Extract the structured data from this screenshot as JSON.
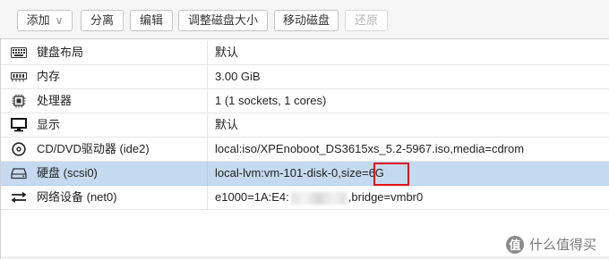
{
  "toolbar": {
    "add_label": "添加",
    "detach_label": "分离",
    "edit_label": "编辑",
    "resize_label": "调整磁盘大小",
    "move_label": "移动磁盘",
    "revert_label": "还原"
  },
  "rows": [
    {
      "icon": "keyboard-icon",
      "name": "键盘布局",
      "value": "默认"
    },
    {
      "icon": "memory-icon",
      "name": "内存",
      "value": "3.00 GiB"
    },
    {
      "icon": "cpu-icon",
      "name": "处理器",
      "value": "1 (1 sockets, 1 cores)"
    },
    {
      "icon": "monitor-icon",
      "name": "显示",
      "value": "默认"
    },
    {
      "icon": "cdrom-icon",
      "name": "CD/DVD驱动器 (ide2)",
      "value": "local:iso/XPEnoboot_DS3615xs_5.2-5967.iso,media=cdrom"
    },
    {
      "icon": "harddisk-icon",
      "name": "硬盘 (scsi0)",
      "value": "local-lvm:vm-101-disk-0,size=6G",
      "selected": true
    },
    {
      "icon": "network-icon",
      "name": "网络设备 (net0)",
      "value_prefix": "e1000=1A:E4:",
      "value_suffix": ",bridge=vmbr0"
    }
  ],
  "watermark": {
    "badge": "值",
    "text": "什么值得买"
  },
  "colors": {
    "selected_row": "#c5daf0",
    "highlight_border": "#e01010",
    "toolbar_bg": "#f5f5f5"
  }
}
